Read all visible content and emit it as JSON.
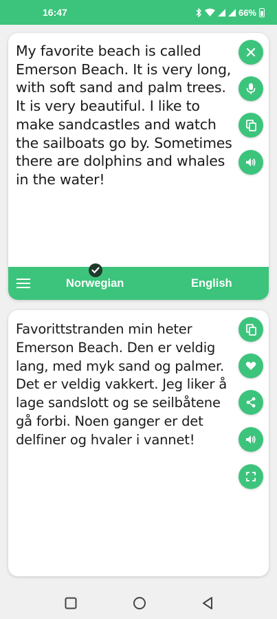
{
  "status": {
    "time": "16:47",
    "battery": "66%"
  },
  "source": {
    "text": "My favorite beach is called Emerson Beach. It is very long, with soft sand and palm trees. It is very beautiful. I like to make sandcastles and watch the sailboats go by. Sometimes there are dolphins and whales in the water!",
    "actions": [
      "close-icon",
      "mic-icon",
      "copy-icon",
      "speaker-icon"
    ]
  },
  "languages": {
    "source": "Norwegian",
    "target": "English"
  },
  "translation": {
    "text": "Favorittstranden min heter Emerson Beach. Den er veldig lang, med myk sand og palmer. Det er veldig vakkert. Jeg liker å lage sandslott og se seilbåtene gå forbi. Noen ganger er det delfiner og hvaler i vannet!",
    "actions": [
      "copy-icon",
      "heart-icon",
      "share-icon",
      "speaker-icon",
      "fullscreen-icon"
    ]
  },
  "colors": {
    "accent": "#3cc47c",
    "badge": "#1f3a2b"
  }
}
